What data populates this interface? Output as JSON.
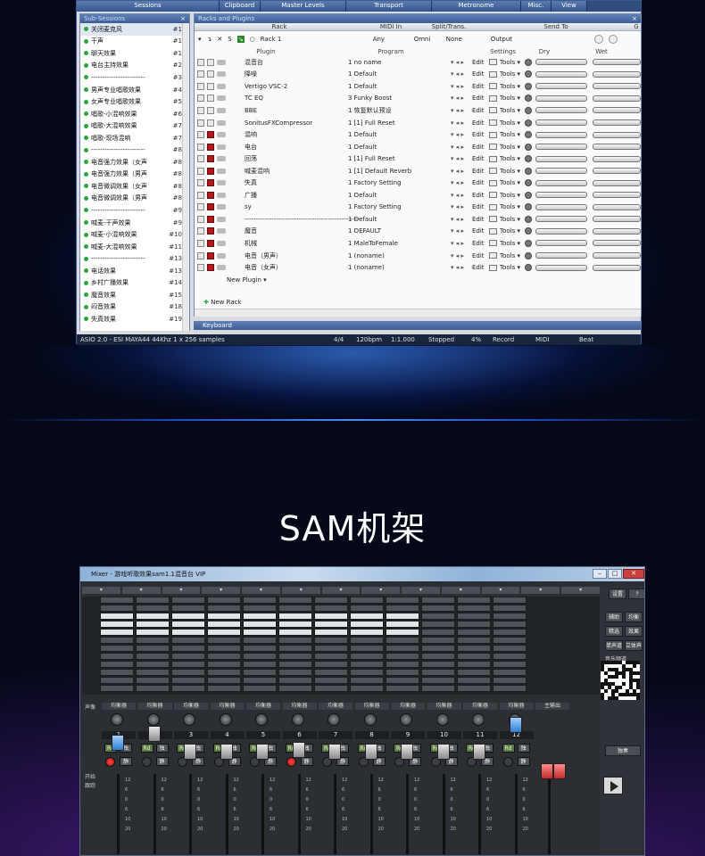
{
  "toolbar": [
    "Sessions",
    "Clipboard",
    "Master Levels",
    "Transport",
    "Metronome",
    "Misc.",
    "View"
  ],
  "sub_sessions": {
    "title": "Sub-Sessions",
    "items": [
      {
        "name": "关闭麦克风",
        "key": "#1"
      },
      {
        "name": "干声",
        "key": "#1"
      },
      {
        "name": "聊天效果",
        "key": "#1"
      },
      {
        "name": "电台主持效果",
        "key": "#2"
      },
      {
        "name": "------------------------",
        "key": "#3"
      },
      {
        "name": "男声专业唱歌效果",
        "key": "#4"
      },
      {
        "name": "女声专业唱歌效果",
        "key": "#5"
      },
      {
        "name": "唱歌-小混响效果",
        "key": "#6"
      },
      {
        "name": "唱歌-大混响效果",
        "key": "#7"
      },
      {
        "name": "唱歌-现场混响",
        "key": "#7"
      },
      {
        "name": "------------------------",
        "key": "#8"
      },
      {
        "name": "电音强力效果（女声",
        "key": "#8"
      },
      {
        "name": "电音强力效果（男声",
        "key": "#8"
      },
      {
        "name": "电音微调效果（女声",
        "key": "#8"
      },
      {
        "name": "电音微调效果（男声",
        "key": "#8"
      },
      {
        "name": "------------------------",
        "key": "#9"
      },
      {
        "name": "喊麦-干声效果",
        "key": "#9"
      },
      {
        "name": "喊麦-小混响效果",
        "key": "#10"
      },
      {
        "name": "喊麦-大混响效果",
        "key": "#11"
      },
      {
        "name": "------------------------",
        "key": "#13"
      },
      {
        "name": "电话效果",
        "key": "#13"
      },
      {
        "name": "乡村广播效果",
        "key": "#14"
      },
      {
        "name": "魔音效果",
        "key": "#15"
      },
      {
        "name": "闷音效果",
        "key": "#18"
      },
      {
        "name": "失真效果",
        "key": "#19"
      }
    ]
  },
  "racks": {
    "title": "Racks and Plugins",
    "headers": [
      "Rack",
      "MIDI In",
      "Split/Trans.",
      "Send To",
      "G"
    ],
    "rack": {
      "name": "Rack 1",
      "midi": "Any",
      "channel": "Omni",
      "split": "None",
      "send": "Output"
    },
    "subheaders": [
      "Plugin",
      "Program",
      "Settings",
      "Dry",
      "Wet"
    ],
    "plugins": [
      {
        "name": "混音台",
        "program": "1 no name",
        "red": false
      },
      {
        "name": "降噪",
        "program": "1 Default",
        "red": false
      },
      {
        "name": "Vertigo VSC-2",
        "program": "1 Default",
        "red": false
      },
      {
        "name": "TC EQ",
        "program": "3 Funky Boost",
        "red": false
      },
      {
        "name": "BBE",
        "program": "1 恢复默认预设",
        "red": false
      },
      {
        "name": "SonitusFXCompressor",
        "program": "1 [1] Full Reset",
        "red": false
      },
      {
        "name": "混响",
        "program": "1 Default",
        "red": true
      },
      {
        "name": "电台",
        "program": "1 Default",
        "red": true
      },
      {
        "name": "回荡",
        "program": "1 [1] Full Reset",
        "red": true
      },
      {
        "name": "喊麦混响",
        "program": "1 [1] Default Reverb",
        "red": true
      },
      {
        "name": "失真",
        "program": "1 Factory Setting",
        "red": true
      },
      {
        "name": "广播",
        "program": "1 Default",
        "red": true
      },
      {
        "name": "sy",
        "program": "1 Factory Setting",
        "red": true
      },
      {
        "name": "----------------------------------------------------",
        "program": "1 Default",
        "red": true
      },
      {
        "name": "魔音",
        "program": "1 DEFAULT",
        "red": true
      },
      {
        "name": "机械",
        "program": "1 MaleToFemale",
        "red": true
      },
      {
        "name": "电音（男声）",
        "program": "1 (noname)",
        "red": true
      },
      {
        "name": "电音（女声）",
        "program": "1 (noname)",
        "red": true
      }
    ],
    "edit_label": "Edit",
    "tools_label": "Tools",
    "new_plugin": "New Plugin",
    "new_rack": "New Rack"
  },
  "keyboard_title": "Keyboard",
  "status": {
    "driver": "ASIO 2.0 - ESI MAYA44 44Khz 1 x 256 samples",
    "sig": "4/4",
    "bpm": "120bpm",
    "pos": "1:1.000",
    "state": "Stopped",
    "cpu": "4%",
    "record": "Record",
    "midi": "MIDI",
    "beat": "Beat"
  },
  "section_title": "SAM机架",
  "mixer": {
    "title": "Mixer - 游戏听歌效果sam1.1混音台 VIP",
    "channels": [
      "1",
      "2",
      "3",
      "4",
      "5",
      "6",
      "7",
      "8",
      "9",
      "10",
      "11",
      "12"
    ],
    "eq_label": "均衡器",
    "rd": "Rd",
    "solo": "独",
    "mute": "静",
    "pan_label": "声像",
    "open_label": "开始",
    "track_label": "跟踪",
    "right_labels": [
      "设置",
      "?",
      "辅助",
      "均衡",
      "精选",
      "效果",
      "单声道",
      "立体声",
      "音乐频道"
    ],
    "solo_r": "独奏",
    "lbl_main": "主输出"
  }
}
